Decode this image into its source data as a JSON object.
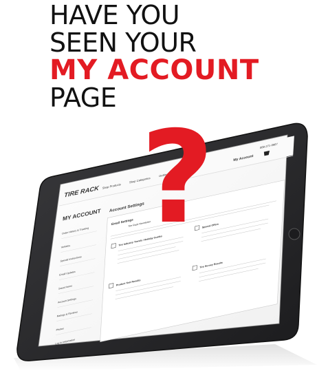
{
  "headline": {
    "line1": "HAVE YOU",
    "line2": "SEEN YOUR",
    "line3": "MY ACCOUNT",
    "line4": "PAGE",
    "question_mark": "?"
  },
  "colors": {
    "accent": "#e31b23",
    "tablet_frame": "#2a2a2c",
    "text": "#111111"
  },
  "screen": {
    "logo": "TIRE RACK",
    "phone": "888-271-9987",
    "nav": [
      "Shop Products",
      "Shop Categories",
      "Getting & Installing"
    ],
    "my_account_header": "My Account",
    "sidebar_title": "MY ACCOUNT",
    "sidebar_items": [
      "Order History & Tracking",
      "Vehicles",
      "Special Instructions",
      "Email Updates",
      "Saved Items",
      "Account Settings",
      "Ratings & Reviews",
      "Photos",
      "Log In Information"
    ],
    "section_title": "Account Settings",
    "email_settings_title": "Email Settings",
    "email_settings_value": "Tire Rack Newsletter",
    "card1_title": "Tire Industry Trends / Holiday Guides",
    "card1_body": "Includes new products, product updates, recommendations, performance advice, tech tips and more.",
    "card2_title": "Special Offers",
    "card2_body": "Hear about special promotions, rebates and other products before anyone else.",
    "card3_title": "Product Test Results",
    "card3_body": "Read the results of tests performed on our on-site test track.",
    "card4_title": "Tire Survey Results",
    "card4_body": "Find out what tires are in the spotlight based on consumer's evaluations."
  }
}
